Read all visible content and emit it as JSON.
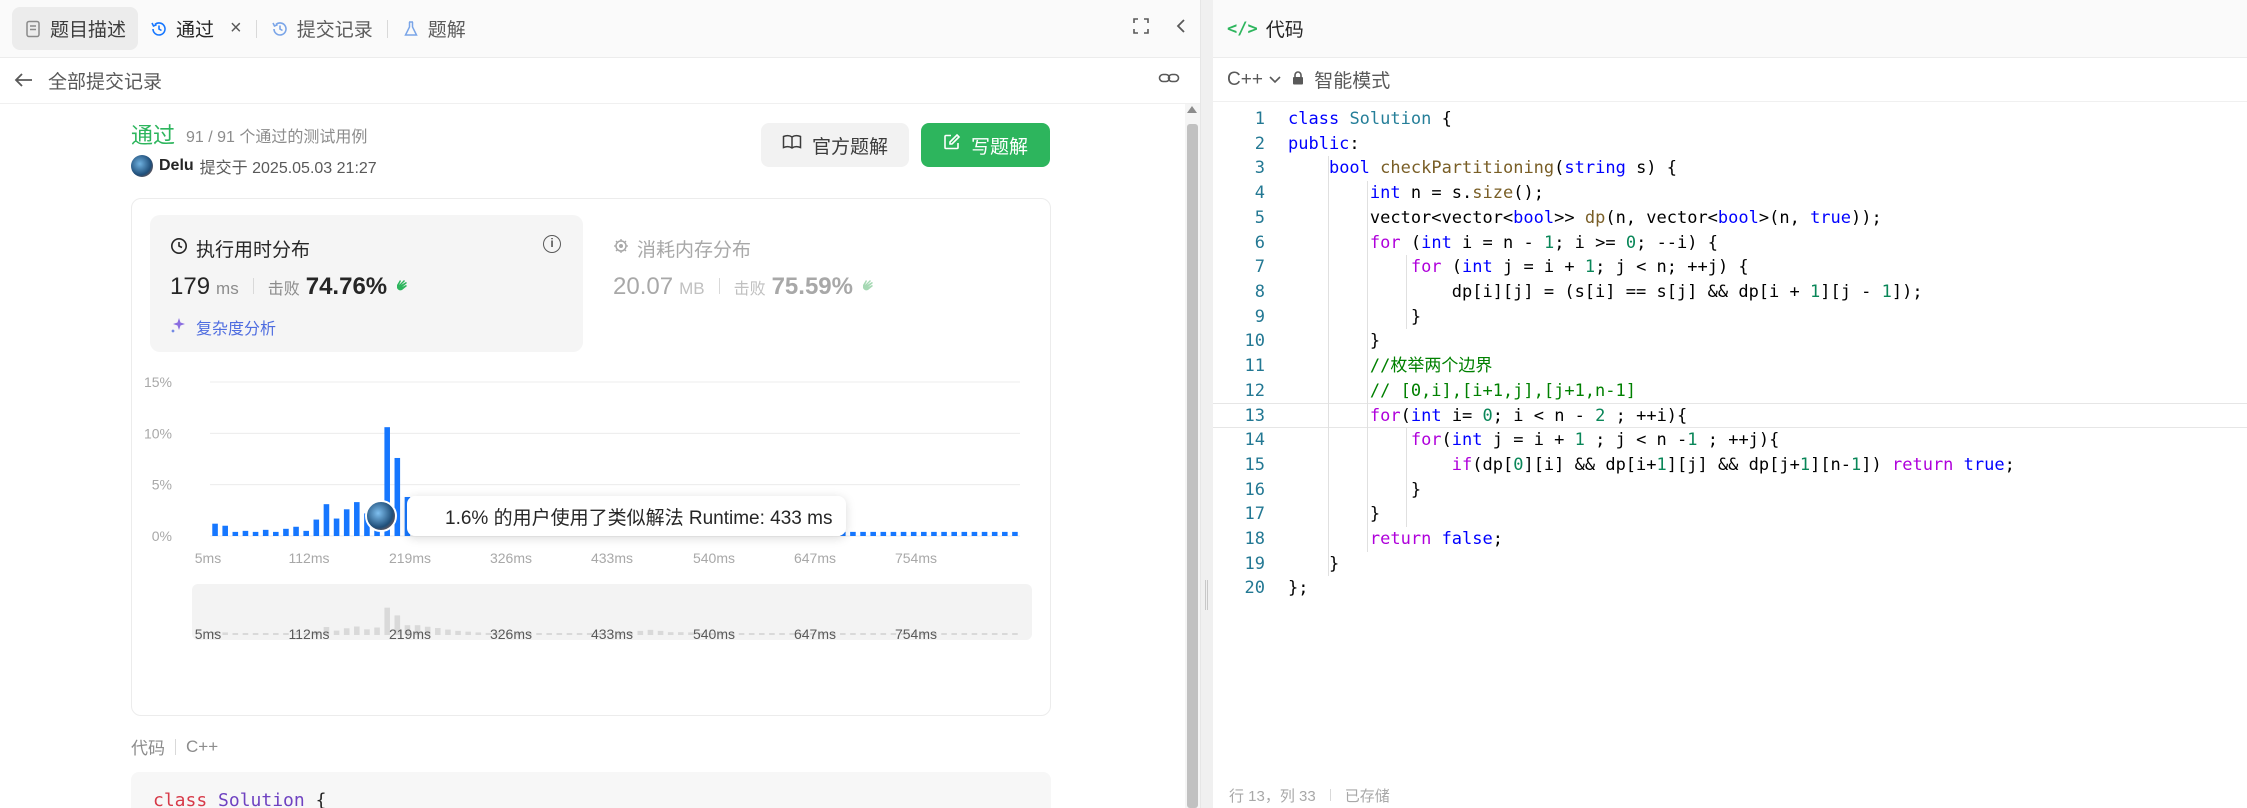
{
  "tabs": [
    {
      "label": "题目描述"
    },
    {
      "label": "通过"
    },
    {
      "label": "提交记录"
    },
    {
      "label": "题解"
    }
  ],
  "back": {
    "label": "全部提交记录"
  },
  "result": {
    "status": "通过",
    "cases": "91 / 91 个通过的测试用例",
    "user": "Delu",
    "submitted_at": "提交于 2025.05.03 21:27"
  },
  "buttons": {
    "official": "官方题解",
    "write": "写题解"
  },
  "runtime": {
    "title": "执行用时分布",
    "value": "179",
    "unit": "ms",
    "beat_label": "击败",
    "beat": "74.76%",
    "complexity": "复杂度分析"
  },
  "memory": {
    "title": "消耗内存分布",
    "value": "20.07",
    "unit": "MB",
    "beat_label": "击败",
    "beat": "75.59%"
  },
  "tooltip": {
    "text": "1.6% 的用户使用了类似解法 Runtime: 433 ms"
  },
  "chart_data": {
    "type": "bar",
    "ylabels": [
      "15%",
      "10%",
      "5%",
      "0%"
    ],
    "xlabels": [
      "5ms",
      "112ms",
      "219ms",
      "326ms",
      "433ms",
      "540ms",
      "647ms",
      "754ms"
    ],
    "ylim": [
      0,
      15
    ],
    "values": [
      1.2,
      1.0,
      0.4,
      0.5,
      0.4,
      0.6,
      0.4,
      0.7,
      0.9,
      0.5,
      1.6,
      3.1,
      1.7,
      2.6,
      3.3,
      2.2,
      2.9,
      10.6,
      7.6,
      3.8,
      3.8,
      3.2,
      2.7,
      2.1,
      1.6,
      1.3,
      1.0,
      0.8,
      1.0,
      0.5,
      0.5,
      0.4,
      0.5,
      0.4,
      0.6,
      0.5,
      0.4,
      0.4,
      0.5,
      0.4,
      0.6,
      1.1,
      1.6,
      2.0,
      1.6,
      1.1,
      1.1,
      1.0,
      0.7,
      0.6,
      0.7,
      0.5,
      0.5,
      0.5,
      0.4,
      0.4,
      0.4,
      0.4,
      0.4,
      0.4,
      0.4,
      0.4,
      0.4,
      0.4,
      0.4,
      0.4,
      0.4,
      0.4,
      0.4,
      0.4,
      0.4,
      0.4,
      0.4,
      0.4,
      0.4,
      0.4,
      0.4,
      0.4,
      0.4,
      0.4
    ],
    "highlight_index": 17,
    "bar_color": "#1677ff",
    "grid": true
  },
  "code_label": {
    "title": "代码",
    "lang": "C++"
  },
  "snippet": {
    "kw": "class",
    "cls": "Solution",
    "brace": "{"
  },
  "editor": {
    "title": "代码",
    "lang": "C++",
    "mode": "智能模式",
    "status_line": "行 13，列 33",
    "status_saved": "已存储",
    "lines": [
      "class Solution {",
      "public:",
      "    bool checkPartitioning(string s) {",
      "        int n = s.size();",
      "        vector<vector<bool>> dp(n, vector<bool>(n, true));",
      "        for (int i = n - 1; i >= 0; --i) {",
      "            for (int j = i + 1; j < n; ++j) {",
      "                dp[i][j] = (s[i] == s[j] && dp[i + 1][j - 1]);",
      "            }",
      "        }",
      "        //枚举两个边界",
      "        // [0,i],[i+1,j],[j+1,n-1]",
      "        for(int i= 0; i < n - 2 ; ++i){",
      "            for(int j = i + 1 ; j < n -1 ; ++j){",
      "                if(dp[0][i] && dp[i+1][j] && dp[j+1][n-1]) return true;",
      "            }",
      "        }",
      "        return false;",
      "    }",
      "};"
    ]
  }
}
